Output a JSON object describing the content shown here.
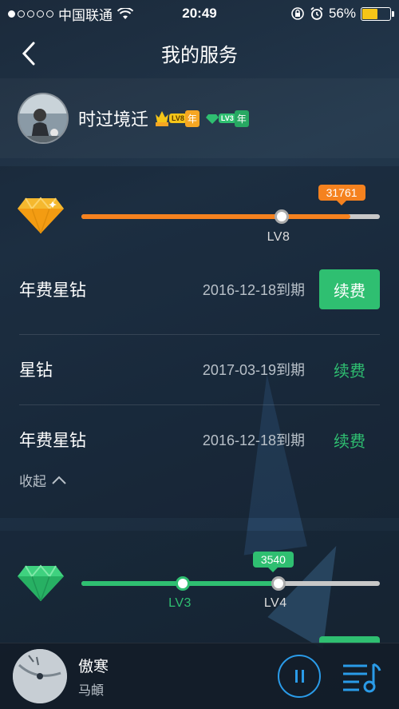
{
  "status_bar": {
    "carrier": "中国联通",
    "time": "20:49",
    "battery": "56%",
    "battery_level": 0.56,
    "signal_bars_filled": 1,
    "signal_bars_total": 5
  },
  "nav": {
    "title": "我的服务"
  },
  "profile": {
    "name": "时过境迁",
    "badges": [
      {
        "level": "LV8",
        "suffix": "年",
        "color": "#f5a623"
      },
      {
        "level": "LV3",
        "suffix": "年",
        "color": "#2fbf71"
      }
    ]
  },
  "diamond_yellow": {
    "score": "31761",
    "level_label": "LV8",
    "progress": 0.9,
    "knob_position": 0.67,
    "color": "#f5821f"
  },
  "memberships": [
    {
      "name": "年费星钻",
      "expiry": "2016-12-18到期",
      "action": "续费",
      "style": "filled"
    },
    {
      "name": "星钻",
      "expiry": "2017-03-19到期",
      "action": "续费",
      "style": "text"
    },
    {
      "name": "年费星钻",
      "expiry": "2016-12-18到期",
      "action": "续费",
      "style": "text"
    }
  ],
  "collapse_label": "收起",
  "diamond_green": {
    "score": "3540",
    "current_level": "LV3",
    "next_level": "LV4",
    "progress": 0.66,
    "current_position": 0.34,
    "next_position": 0.66,
    "color": "#2fbf71"
  },
  "player": {
    "title": "傲寒",
    "artist": "马頔"
  },
  "colors": {
    "accent_green": "#2fbf71",
    "accent_orange": "#f5821f",
    "accent_blue": "#2a9be8"
  }
}
